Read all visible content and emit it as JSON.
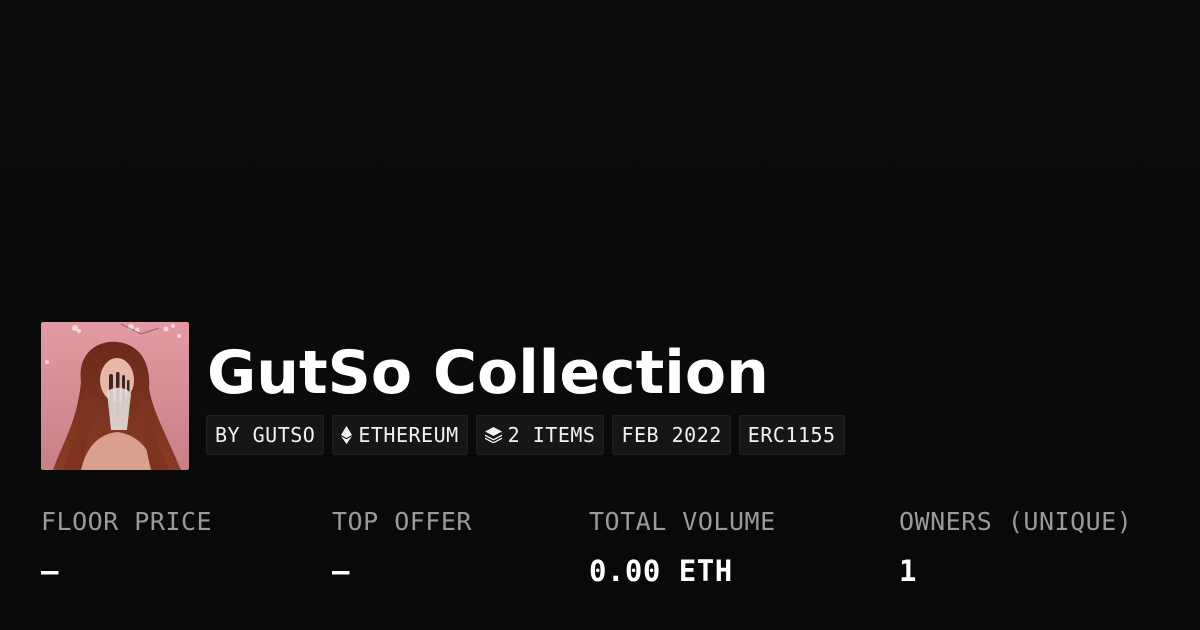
{
  "collection": {
    "title": "GutSo Collection",
    "avatar_alt": "collection-avatar"
  },
  "tags": [
    {
      "label": "BY GUTSO",
      "icon": ""
    },
    {
      "label": "ETHEREUM",
      "icon": "ethereum-icon"
    },
    {
      "label": "2 ITEMS",
      "icon": "layers-icon"
    },
    {
      "label": "FEB 2022",
      "icon": ""
    },
    {
      "label": "ERC1155",
      "icon": ""
    }
  ],
  "stats": [
    {
      "label": "FLOOR PRICE",
      "value": "—"
    },
    {
      "label": "TOP OFFER",
      "value": "—"
    },
    {
      "label": "TOTAL VOLUME",
      "value": "0.00 ETH"
    },
    {
      "label": "OWNERS (UNIQUE)",
      "value": "1"
    }
  ],
  "colors": {
    "background": "#0a0a0a",
    "tag_background": "#161616",
    "text_primary": "#ffffff",
    "text_muted": "#9a9a9a",
    "avatar_pink": "#d98a93"
  }
}
